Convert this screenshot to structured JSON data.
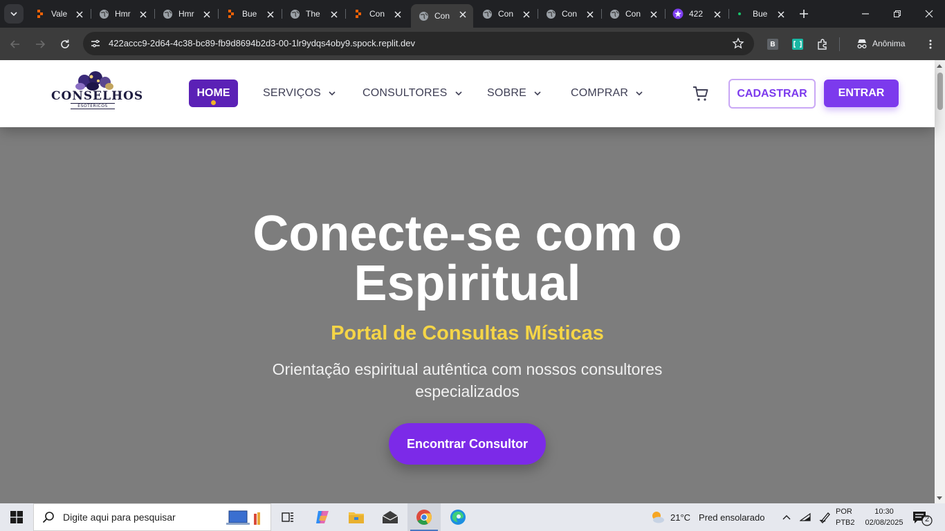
{
  "browser": {
    "tabs": [
      {
        "title": "Vale",
        "favicon": "replit-icon"
      },
      {
        "title": "Hmr",
        "favicon": "globe-icon"
      },
      {
        "title": "Hmr",
        "favicon": "globe-icon"
      },
      {
        "title": "Bue",
        "favicon": "replit-icon"
      },
      {
        "title": "The",
        "favicon": "globe-icon"
      },
      {
        "title": "Con",
        "favicon": "replit-icon"
      },
      {
        "title": "Con",
        "favicon": "globe-icon",
        "active": true
      },
      {
        "title": "Con",
        "favicon": "globe-icon"
      },
      {
        "title": "Con",
        "favicon": "globe-icon"
      },
      {
        "title": "Con",
        "favicon": "globe-icon"
      },
      {
        "title": "422",
        "favicon": "purple-star-icon"
      },
      {
        "title": "Bue",
        "favicon": "green-dot-icon"
      }
    ],
    "url": "422accc9-2d64-4c38-bc89-fb9d8694b2d3-00-1lr9ydqs4oby9.spock.replit.dev",
    "profile_label": "Anônima",
    "extension_letter": "B"
  },
  "site": {
    "logo_text": "CONSELHOS",
    "logo_subtext": "ESOTÉRICOS",
    "nav": {
      "home": "HOME",
      "servicos": "SERVIÇOS",
      "consultores": "CONSULTORES",
      "sobre": "SOBRE",
      "comprar": "COMPRAR"
    },
    "buttons": {
      "cadastrar": "CADASTRAR",
      "entrar": "ENTRAR"
    },
    "hero": {
      "title": "Conecte-se com o Espiritual",
      "subtitle": "Portal de Consultas Místicas",
      "description": "Orientação espiritual autêntica com nossos consultores especializados",
      "cta": "Encontrar Consultor"
    },
    "colors": {
      "primary_purple": "#7c3aed",
      "dark_purple": "#5b21b6",
      "accent_yellow": "#f5d547"
    }
  },
  "taskbar": {
    "search_placeholder": "Digite aqui para pesquisar",
    "weather_temp": "21°C",
    "weather_desc": "Pred ensolarado",
    "lang_line1": "POR",
    "lang_line2": "PTB2",
    "time": "10:30",
    "date": "02/08/2025",
    "notification_count": "2"
  }
}
